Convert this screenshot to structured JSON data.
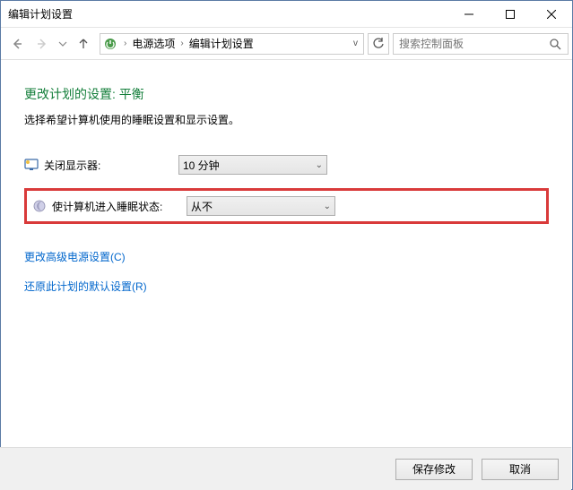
{
  "window": {
    "title": "编辑计划设置"
  },
  "breadcrumb": {
    "item1": "电源选项",
    "item2": "编辑计划设置"
  },
  "search": {
    "placeholder": "搜索控制面板"
  },
  "page": {
    "title": "更改计划的设置: 平衡",
    "description": "选择希望计算机使用的睡眠设置和显示设置。"
  },
  "settings": {
    "display_off": {
      "label": "关闭显示器:",
      "value": "10 分钟"
    },
    "sleep": {
      "label": "使计算机进入睡眠状态:",
      "value": "从不"
    }
  },
  "links": {
    "advanced": "更改高级电源设置(C)",
    "restore": "还原此计划的默认设置(R)"
  },
  "buttons": {
    "save": "保存修改",
    "cancel": "取消"
  }
}
